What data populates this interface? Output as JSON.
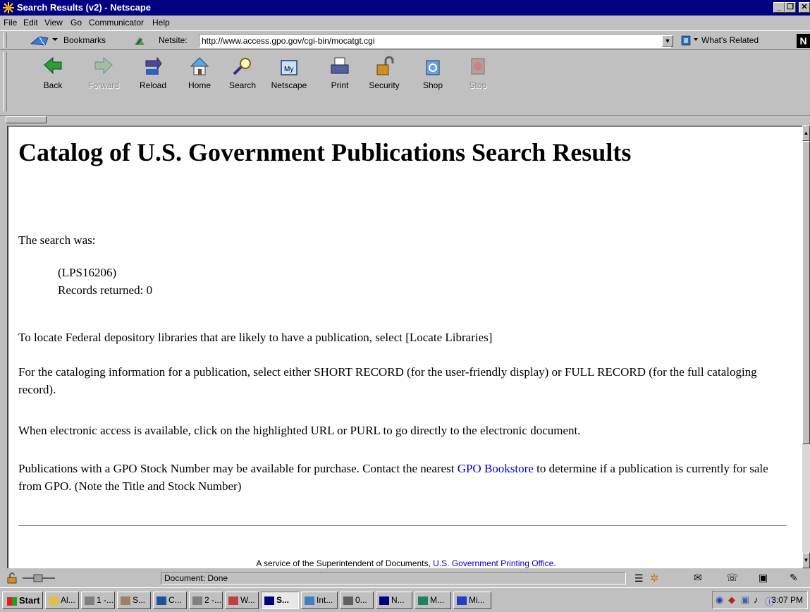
{
  "window": {
    "title": "Search Results (v2) - Netscape",
    "controls": [
      "_",
      "❐",
      "✕"
    ]
  },
  "menu": [
    "File",
    "Edit",
    "View",
    "Go",
    "Communicator",
    "Help"
  ],
  "location_bar": {
    "bookmarks_label": "Bookmarks",
    "netsite_label": "Netsite:",
    "url": "http://www.access.gpo.gov/cgi-bin/mocatgt.cgi",
    "related_label": "What's Related"
  },
  "toolbar": [
    {
      "label": "Back",
      "icon": "back-arrow-icon",
      "enabled": true
    },
    {
      "label": "Forward",
      "icon": "forward-arrow-icon",
      "enabled": false
    },
    {
      "label": "Reload",
      "icon": "reload-icon",
      "enabled": true
    },
    {
      "label": "Home",
      "icon": "home-icon",
      "enabled": true
    },
    {
      "label": "Search",
      "icon": "search-icon",
      "enabled": true
    },
    {
      "label": "Netscape",
      "icon": "my-netscape-icon",
      "enabled": true
    },
    {
      "label": "Print",
      "icon": "printer-icon",
      "enabled": true
    },
    {
      "label": "Security",
      "icon": "padlock-icon",
      "enabled": true
    },
    {
      "label": "Shop",
      "icon": "shop-bag-icon",
      "enabled": true
    },
    {
      "label": "Stop",
      "icon": "stop-icon",
      "enabled": false
    }
  ],
  "page": {
    "title": "Catalog of U.S. Government Publications Search Results",
    "search_intro": "The search was:",
    "query": "(LPS16206)",
    "records": "Records returned: 0",
    "locate_text": "To locate Federal depository libraries that are likely to have a publication, select [Locate Libraries]",
    "record_text": "For the cataloging information for a publication, select either SHORT RECORD (for the user-friendly display) or FULL RECORD (for the full cataloging record).",
    "electronic_text": "When electronic access is available, click on the highlighted URL or PURL to go directly to the electronic document.",
    "purchase_before": "Publications with a GPO Stock Number may be available for purchase. Contact the nearest ",
    "bookstore_link": "GPO Bookstore",
    "purchase_after": " to determine if a publication is currently for sale from GPO. (Note the Title and Stock Number)",
    "footer_text": "A service of the Superintendent of Documents, ",
    "footer_link": "U.S. Government Printing Office",
    "footer_end": "."
  },
  "status": {
    "text": "Document: Done"
  },
  "taskbar": {
    "start": "Start",
    "tasks": [
      "Al...",
      "1 -...",
      "S...",
      "C...",
      "2 -...",
      "W...",
      "S...",
      "Int...",
      "0...",
      "N...",
      "M...",
      "Mi..."
    ],
    "active_index": 6,
    "clock": "3:07 PM"
  },
  "colors": {
    "titlebar": "#000080",
    "chrome": "#c0c0c0",
    "link": "#0000cc"
  }
}
